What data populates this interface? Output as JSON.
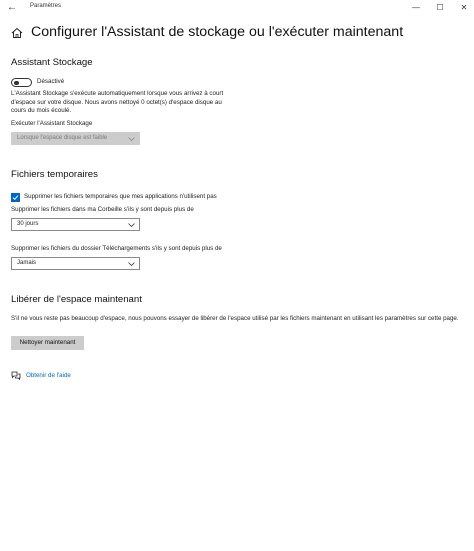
{
  "window": {
    "title": "Paramètres",
    "back": "←",
    "minimize": "—",
    "maximize": "☐",
    "close": "✕"
  },
  "page": {
    "title": "Configurer l'Assistant de stockage ou l'exécuter maintenant"
  },
  "storage_sense": {
    "title": "Assistant Stockage",
    "toggle_state": "Désactivé",
    "toggle_on": false,
    "description": "L'Assistant Stockage s'exécute automatiquement lorsque vous arrivez à court d'espace sur votre disque. Nous avons nettoyé 0 octet(s) d'espace disque au cours du mois écoulé.",
    "run_label": "Exécuter l'Assistant Stockage",
    "run_value": "Lorsque l'espace disque est faible"
  },
  "temp_files": {
    "title": "Fichiers temporaires",
    "checkbox_label": "Supprimer les fichiers temporaires que mes applications n'utilisent pas",
    "checked": true,
    "recycle_label": "Supprimer les fichiers dans ma Corbeille s'ils y sont depuis plus de",
    "recycle_value": "30 jours",
    "downloads_label": "Supprimer les fichiers du dossier Téléchargements s'ils y sont depuis plus de",
    "downloads_value": "Jamais"
  },
  "free_now": {
    "title": "Libérer de l'espace maintenant",
    "description": "S'il ne vous reste pas beaucoup d'espace, nous pouvons essayer de libérer de l'espace utilisé par les fichiers maintenant en utilisant les paramètres sur cette page.",
    "button_label": "Nettoyer maintenant"
  },
  "help": {
    "link_label": "Obtenir de l'aide"
  },
  "colors": {
    "accent": "#0067c0",
    "disabled": "#cccccc"
  },
  "icons": {
    "home": "home-icon",
    "help": "help-chat-icon",
    "check": "checkmark-icon",
    "chevron": "chevron-down-icon"
  }
}
